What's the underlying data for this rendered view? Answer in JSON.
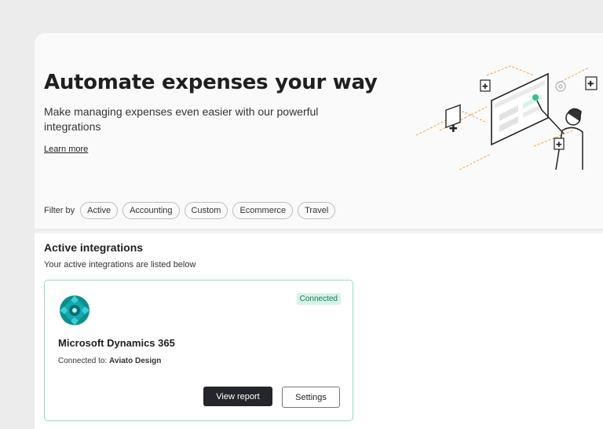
{
  "hero": {
    "title": "Automate expenses your way",
    "subtitle": "Make managing expenses even easier with our powerful integrations",
    "learn_more": "Learn more"
  },
  "filter": {
    "label": "Filter by",
    "chips": [
      "Active",
      "Accounting",
      "Custom",
      "Ecommerce",
      "Travel"
    ]
  },
  "active": {
    "heading": "Active integrations",
    "description": "Your active integrations are listed below",
    "card": {
      "status": "Connected",
      "name": "Microsoft Dynamics 365",
      "connected_label": "Connected to:",
      "connected_value": "Aviato Design",
      "view_report": "View report",
      "settings": "Settings"
    }
  },
  "colors": {
    "accent": "#0e8f8a",
    "status_bg": "#d7f3e8",
    "status_text": "#137a58",
    "card_border": "#9ad6c4",
    "illustration_accent": "#f0a050"
  },
  "icons": [
    "microsoft-dynamics-logo-icon",
    "puzzle-icon",
    "integration-illustration"
  ]
}
